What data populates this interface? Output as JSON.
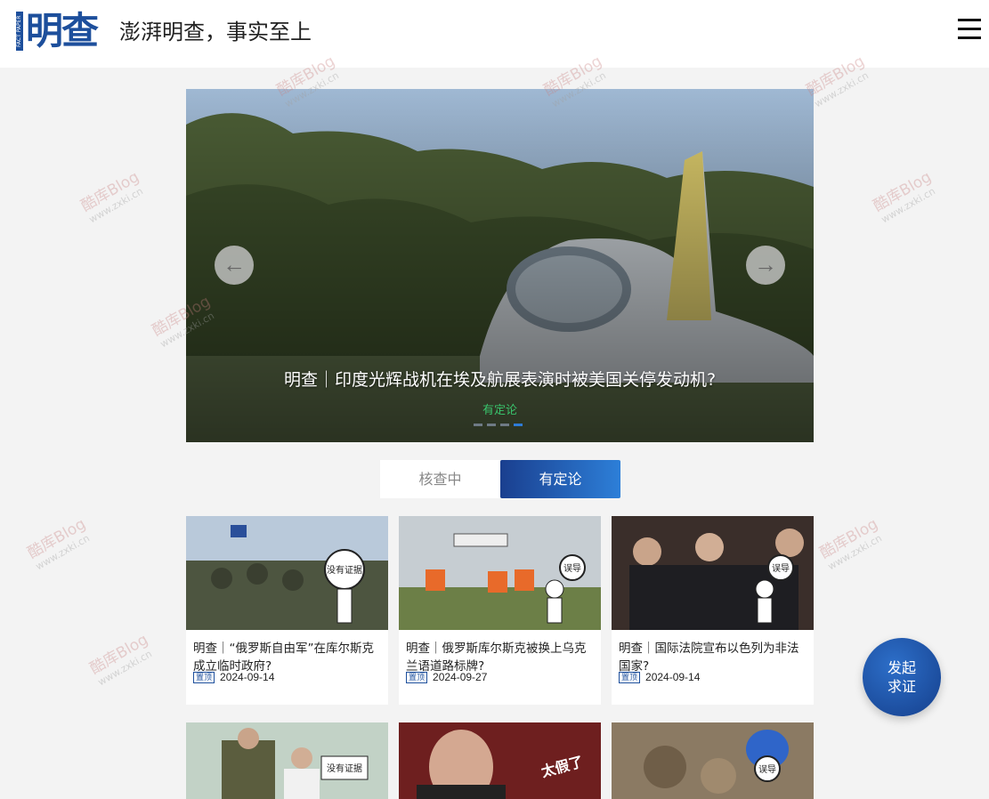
{
  "header": {
    "logo_side_text": "FACT PAPER",
    "logo_text": "明查",
    "slogan": "澎湃明查，事实至上",
    "menu_icon": "hamburger-menu-icon"
  },
  "carousel": {
    "slide_title": "明查｜印度光辉战机在埃及航展表演时被美国关停发动机?",
    "slide_status": "有定论",
    "prev_icon": "arrow-left-icon",
    "next_icon": "arrow-right-icon",
    "slide_count": 4,
    "active_index": 3
  },
  "tabs": [
    {
      "label": "核查中",
      "active": false
    },
    {
      "label": "有定论",
      "active": true
    }
  ],
  "cards": [
    {
      "title": "明查｜“俄罗斯自由军”在库尔斯克成立临时政府?",
      "badge": "置顶",
      "date": "2024-09-14",
      "sign": "没有证据"
    },
    {
      "title": "明查｜俄罗斯库尔斯克被换上乌克兰语道路标牌?",
      "badge": "置顶",
      "date": "2024-09-27",
      "sign": "误导"
    },
    {
      "title": "明查｜国际法院宣布以色列为非法国家?",
      "badge": "置顶",
      "date": "2024-09-14",
      "sign": "误导"
    },
    {
      "sign": "没有证据"
    },
    {
      "sign": "太假了"
    },
    {
      "sign": "误导"
    }
  ],
  "fab": {
    "line1": "发起",
    "line2": "求证"
  },
  "watermark": {
    "text": "酷库Blog",
    "url": "www.zxki.cn"
  }
}
